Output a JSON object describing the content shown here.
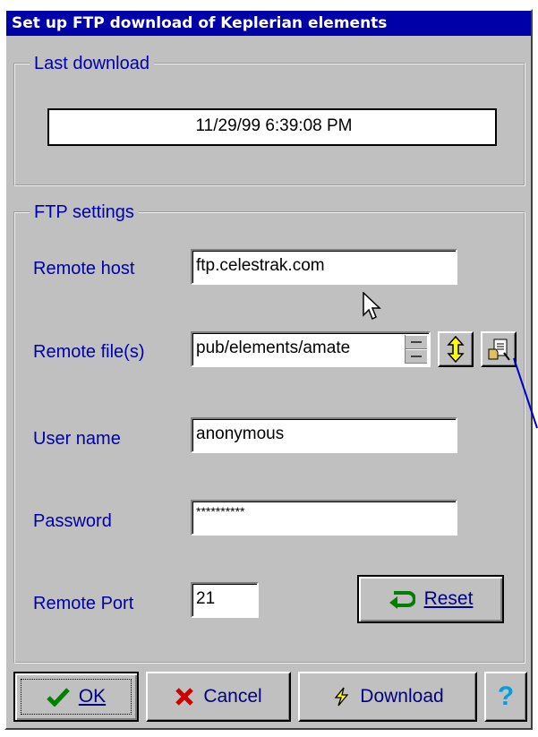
{
  "window": {
    "title": "Set up FTP download of Keplerian elements"
  },
  "last_download": {
    "group_title": "Last download",
    "value": "11/29/99 6:39:08 PM"
  },
  "ftp": {
    "group_title": "FTP settings",
    "remote_host_label": "Remote host",
    "remote_host_value": "ftp.celestrak.com",
    "remote_files_label": "Remote file(s)",
    "remote_files_value": "pub/elements/amate",
    "user_name_label": "User name",
    "user_name_value": "anonymous",
    "password_label": "Password",
    "password_value": "**********",
    "remote_port_label": "Remote Port",
    "remote_port_value": "21",
    "reset_label": "Reset"
  },
  "buttons": {
    "ok_label": "OK",
    "cancel_label": "Cancel",
    "download_label": "Download",
    "help_label": "?"
  },
  "icons": [
    "check-icon",
    "x-icon",
    "lightning-icon",
    "help-icon",
    "up-down-arrows-icon",
    "file-browse-icon",
    "reset-arrow-icon",
    "mouse-cursor-icon"
  ]
}
